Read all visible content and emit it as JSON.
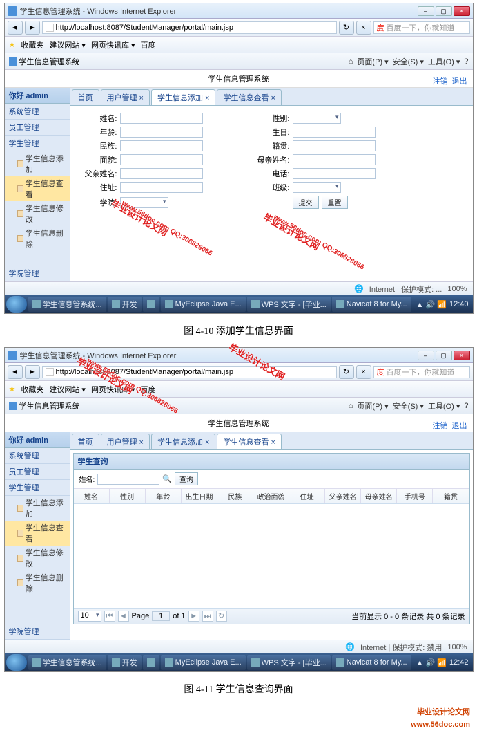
{
  "figA": {
    "caption": "图 4-10  添加学生信息界面",
    "window_title": "学生信息管理系统 - Windows Internet Explorer",
    "url": "http://localhost:8087/StudentManager/portal/main.jsp",
    "search_placeholder": "百度一下，你就知道",
    "fav_label": "收藏夹",
    "fav_links": [
      "建议网站 ▾",
      "网页快讯库 ▾",
      "百度"
    ],
    "tab_label": "学生信息管理系统",
    "ie_menus": [
      "▾",
      "▾",
      "页面(P) ▾",
      "安全(S) ▾",
      "工具(O) ▾",
      "?"
    ],
    "page_heading": "学生信息管理系统",
    "top_links": [
      "注销",
      "退出"
    ],
    "sidebar": {
      "greet": "你好 admin",
      "groups": [
        "系统管理",
        "员工管理",
        "学生管理"
      ],
      "items": [
        "学生信息添加",
        "学生信息查看",
        "学生信息修改",
        "学生信息删除"
      ],
      "selected": 1,
      "bottom": "学院管理"
    },
    "tabs": [
      "首页",
      "用户管理 ×",
      "学生信息添加 ×",
      "学生信息查看 ×"
    ],
    "active_tab": 2,
    "form": {
      "labels": {
        "name": "姓名:",
        "gender": "性别:",
        "age": "年龄:",
        "birth": "生日:",
        "ethnic": "民族:",
        "native": "籍贯:",
        "political": "面貌:",
        "mother": "母亲姓名:",
        "father": "父亲姓名:",
        "phone": "电话:",
        "address": "住址:",
        "class": "班级:",
        "college": "学院:"
      },
      "buttons": {
        "submit": "提交",
        "reset": "重置"
      }
    },
    "status": {
      "zone": "Internet | 保护模式: ...",
      "zoom": "100%"
    },
    "taskbar": {
      "apps": [
        "学生信息管系统...",
        "开发",
        "",
        "MyEclipse Java E...",
        "WPS 文字 - [毕业...",
        "Navicat 8 for My..."
      ],
      "time": "12:40"
    }
  },
  "figB": {
    "caption": "图 4-11  学生信息查询界面",
    "window_title": "学生信息管理系统 - Windows Internet Explorer",
    "url": "http://localhost:8087/StudentManager/portal/main.jsp",
    "search_placeholder": "百度一下，你就知道",
    "fav_label": "收藏夹",
    "fav_links": [
      "建议网站 ▾",
      "网页快讯库 ▾",
      "百度"
    ],
    "tab_label": "学生信息管理系统",
    "ie_menus": [
      "▾",
      "▾",
      "页面(P) ▾",
      "安全(S) ▾",
      "工具(O) ▾",
      "?"
    ],
    "page_heading": "学生信息管理系统",
    "top_links": [
      "注销",
      "退出"
    ],
    "sidebar": {
      "greet": "你好 admin",
      "groups": [
        "系统管理",
        "员工管理",
        "学生管理"
      ],
      "items": [
        "学生信息添加",
        "学生信息查看",
        "学生信息修改",
        "学生信息删除"
      ],
      "selected": 1,
      "bottom": "学院管理"
    },
    "tabs": [
      "首页",
      "用户管理 ×",
      "学生信息添加 ×",
      "学生信息查看 ×"
    ],
    "active_tab": 3,
    "panel_title": "学生查询",
    "search": {
      "label": "姓名:",
      "button": "查询"
    },
    "columns": [
      "姓名",
      "性别",
      "年龄",
      "出生日期",
      "民族",
      "政治面貌",
      "住址",
      "父亲姓名",
      "母亲姓名",
      "手机号",
      "籍贯"
    ],
    "pager": {
      "size": "10",
      "page_label": "Page",
      "page": "1",
      "of_label": "of 1",
      "status": "当前显示 0 - 0 条记录 共 0 条记录"
    },
    "status": {
      "zone": "Internet | 保护模式: 禁用",
      "zoom": "100%"
    },
    "taskbar": {
      "apps": [
        "学生信息管系统...",
        "开发",
        "",
        "MyEclipse Java E...",
        "WPS 文字 - [毕业...",
        "Navicat 8 for My..."
      ],
      "time": "12:42"
    }
  },
  "watermark": {
    "text1": "毕业设计论文网",
    "text2": "www.56doc.com  QQ:306826066",
    "brand": "毕业设计论文网",
    "url": "www.56doc.com"
  }
}
